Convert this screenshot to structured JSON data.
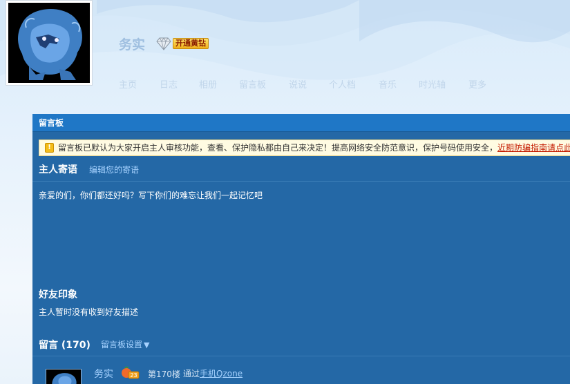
{
  "profile": {
    "nickname": "务实",
    "vip_label": "开通黄钻"
  },
  "nav": {
    "items": [
      "主页",
      "日志",
      "相册",
      "留言板",
      "说说",
      "个人档",
      "音乐",
      "时光轴",
      "更多"
    ]
  },
  "panel": {
    "title": "留言板",
    "notice": {
      "icon": "!",
      "text": "留言板已默认为大家开启主人审核功能，查看、保护隐私都由自己来决定！提高网络安全防范意识，保护号码使用安全，",
      "link": "近期防骗指南请点此"
    },
    "host_message": {
      "title": "主人寄语",
      "edit_link": "编辑您的寄语",
      "text": "亲爱的们，你们都还好吗？写下你们的难忘让我们一起记忆吧"
    },
    "friend_impression": {
      "title": "好友印象",
      "text": "主人暂时没有收到好友描述"
    },
    "comments": {
      "title": "留言 (170)",
      "settings_link": "留言板设置",
      "first": {
        "name": "务实",
        "level_badge": "23",
        "floor": "第170楼",
        "source_prefix": "通过",
        "source_link": "手机Qzone"
      }
    }
  },
  "colors": {
    "panel_bg": "#2468a6",
    "panel_header": "#1f77c6",
    "link": "#a6d2ff",
    "notice_bg": "#fffbe2",
    "notice_link": "#c41b00"
  }
}
